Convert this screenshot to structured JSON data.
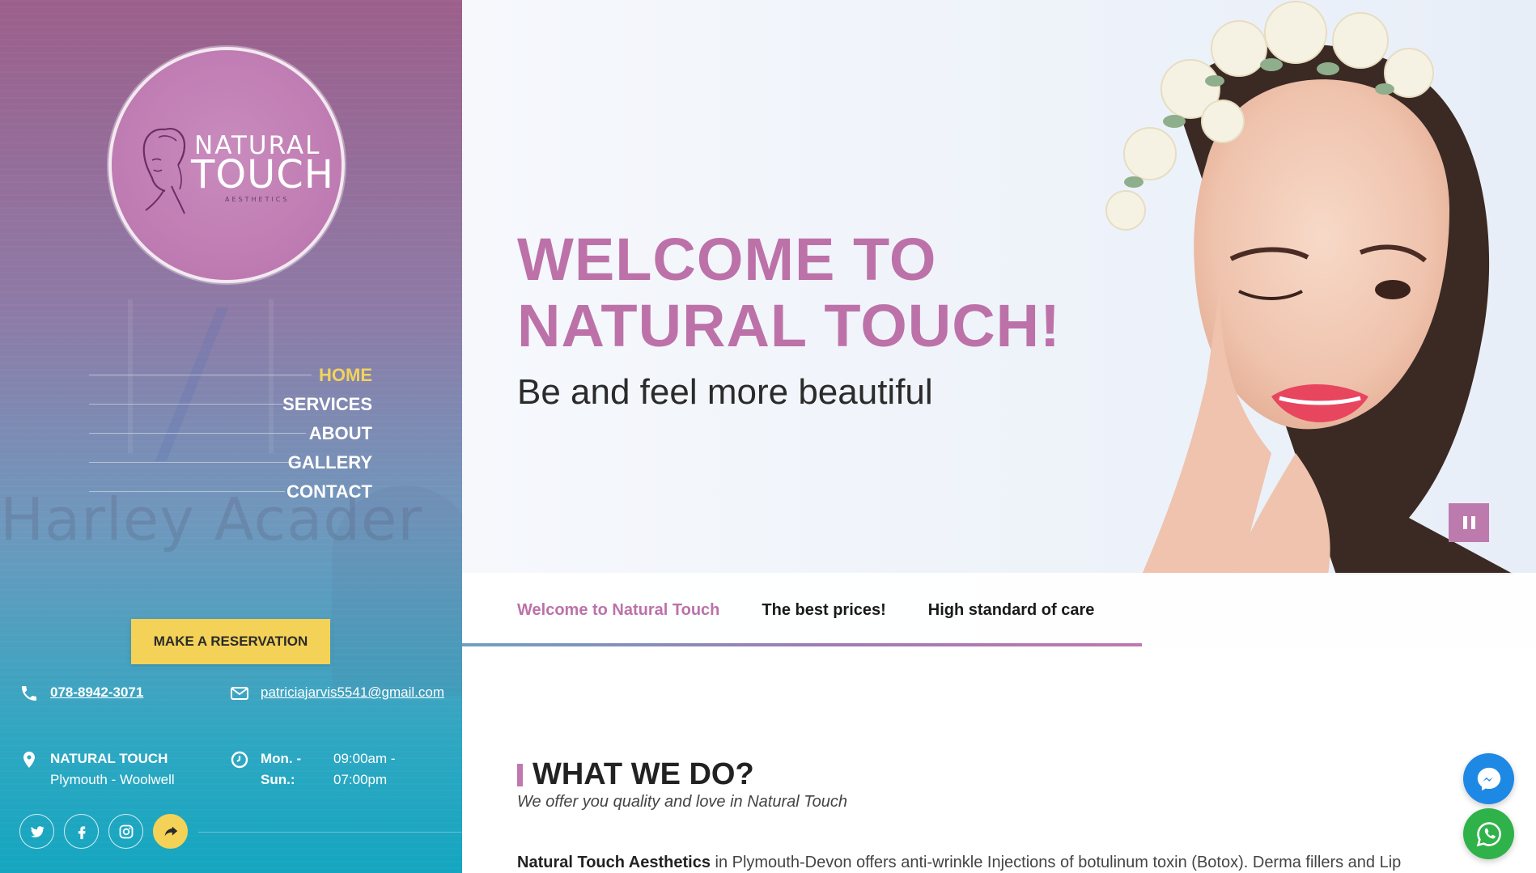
{
  "logo": {
    "line1": "NATURAL",
    "line2": "TOUCH",
    "line3": "AESTHETICS"
  },
  "sidebar": {
    "ghost_text": "Harley Acader",
    "nav": [
      {
        "label": "HOME",
        "active": true
      },
      {
        "label": "SERVICES",
        "active": false
      },
      {
        "label": "ABOUT",
        "active": false
      },
      {
        "label": "GALLERY",
        "active": false
      },
      {
        "label": "CONTACT",
        "active": false
      }
    ],
    "reserve_label": "MAKE A RESERVATION",
    "contact": {
      "phone": "078-8942-3071",
      "email": "patriciajarvis5541@gmail.com",
      "address_name": "NATURAL TOUCH",
      "address_line": "Plymouth - Woolwell",
      "hours_days_1": "Mon. -",
      "hours_days_2": "Sun.:",
      "hours_time_1": "09:00am -",
      "hours_time_2": "07:00pm"
    },
    "socials": [
      "twitter-icon",
      "facebook-icon",
      "instagram-icon",
      "share-icon"
    ]
  },
  "hero": {
    "title_line1": "WELCOME TO",
    "title_line2": "NATURAL TOUCH!",
    "subtitle": "Be and feel more beautiful"
  },
  "slide_tabs": [
    {
      "label": "Welcome to Natural Touch",
      "active": true
    },
    {
      "label": "The best prices!",
      "active": false
    },
    {
      "label": "High standard of care",
      "active": false
    }
  ],
  "content": {
    "section_title": "WHAT WE DO?",
    "section_subtitle": "We offer you quality and love in Natural Touch",
    "body_bold": "Natural Touch Aesthetics",
    "body_rest": " in Plymouth-Devon offers anti-wrinkle Injections of botulinum toxin (Botox). Derma fillers and Lip"
  },
  "colors": {
    "accent_pink": "#bc72a8",
    "accent_yellow": "#f4d257",
    "messenger_blue": "#1e88e5",
    "whatsapp_green": "#2fb24a"
  }
}
